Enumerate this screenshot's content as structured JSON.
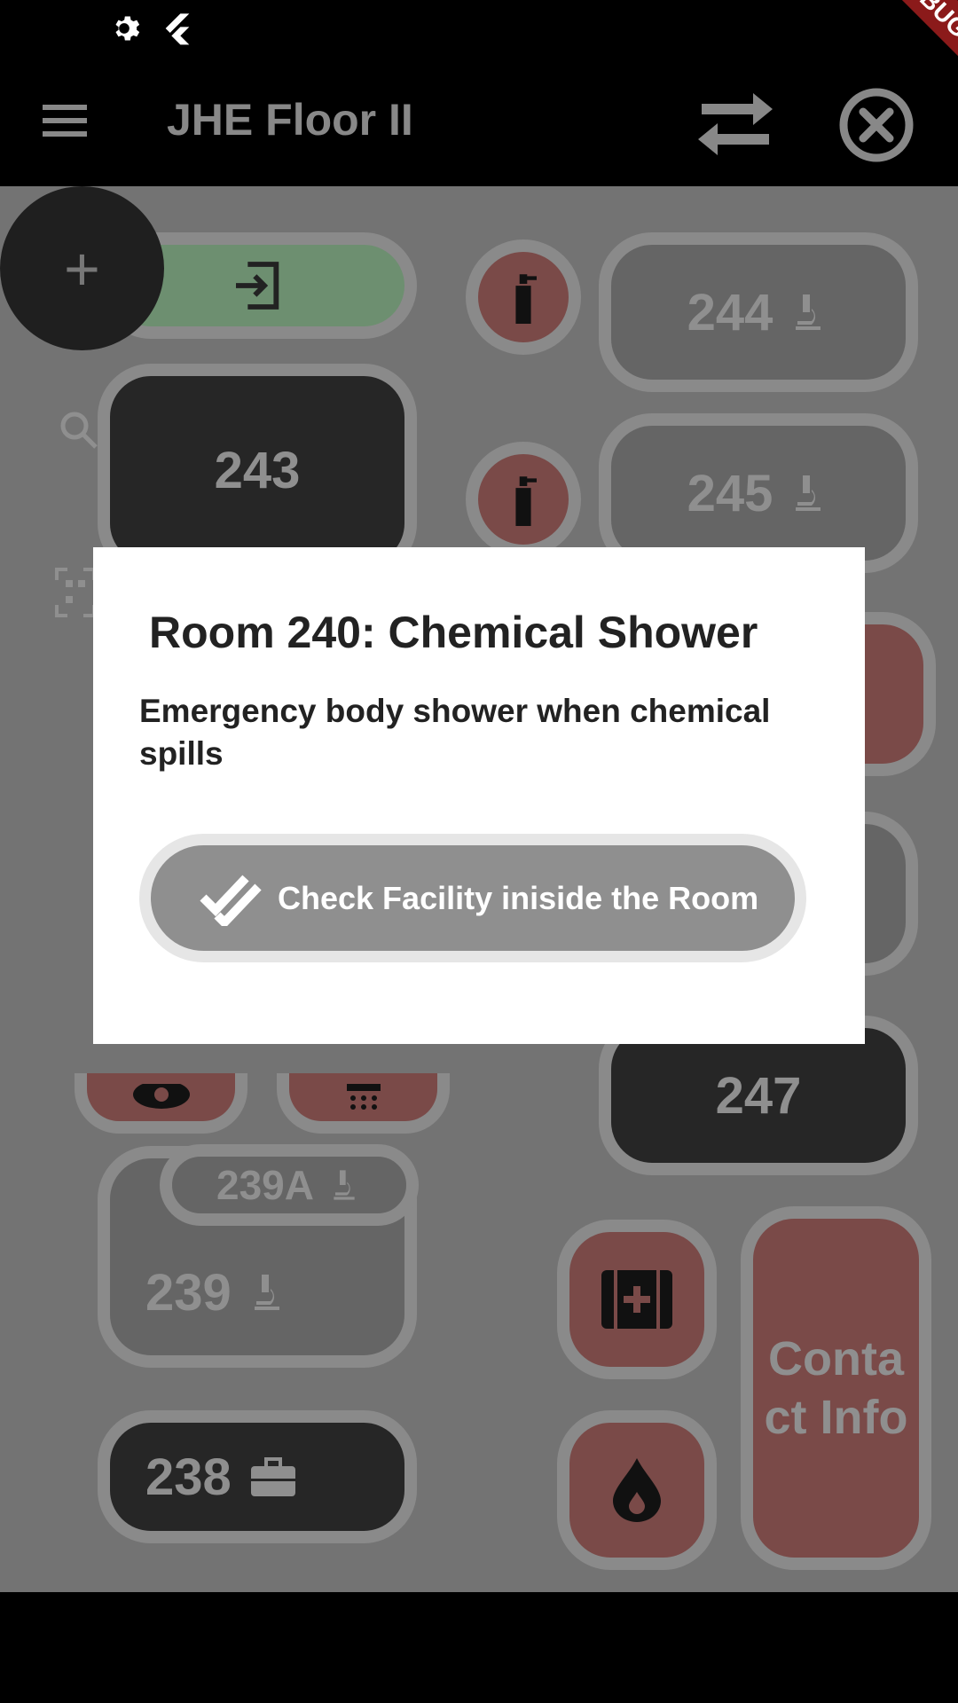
{
  "appbar": {
    "title": "JHE Floor II",
    "debug_banner": "DEBUG"
  },
  "map": {
    "fab_label": "+",
    "rooms": {
      "r243": "243",
      "r244": "244",
      "r245": "245",
      "r247": "247",
      "r239": "239",
      "r239a": "239A",
      "r238": "238",
      "contact": "Contact Info"
    }
  },
  "dialog": {
    "title": "Room 240: Chemical Shower",
    "description": "Emergency body shower when chemical spills",
    "button_label": "Check Facility iniside the Room"
  },
  "colors": {
    "accent_red": "#7a4a48",
    "exit_green": "#6d8f70"
  }
}
